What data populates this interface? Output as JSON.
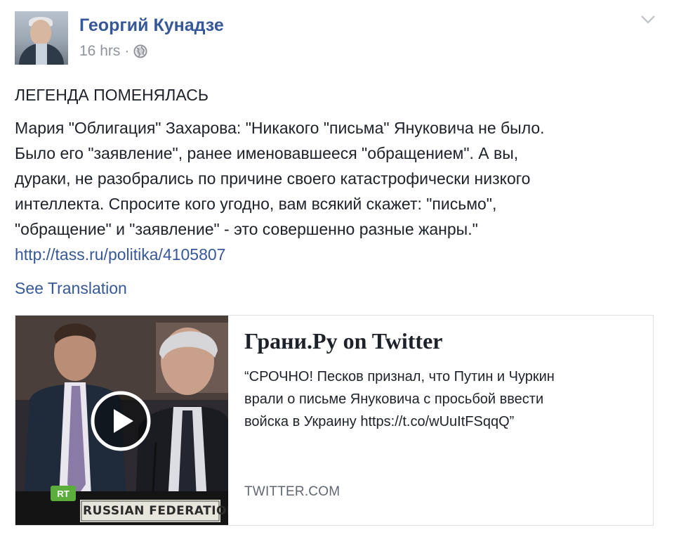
{
  "post": {
    "author_name": "Георгий Кунадзе",
    "timestamp": "16 hrs",
    "separator": "·",
    "privacy_icon": "globe-icon",
    "menu_icon": "chevron-down-icon",
    "headline": "ЛЕГЕНДА ПОМЕНЯЛАСЬ",
    "text_lines": [
      "Мария \"Облигация\" Захарова: \"Никакого \"письма\" Януковича не было.",
      "Было его \"заявление\", ранее именовавшееся \"обращением\". А вы,",
      "дураки, не разобрались по причине своего катастрофически низкого",
      "интеллекта. Спросите кого угодно, вам всякий скажет: \"письмо\",",
      "\"обращение\" и \"заявление\" - это совершенно разные жанры.\""
    ],
    "link": "http://tass.ru/politika/4105807",
    "see_translation": "See Translation"
  },
  "link_card": {
    "title": "Грани.Ру on Twitter",
    "description_lines": [
      "“СРОЧНО! Песков признал, что Путин и Чуркин",
      "врали о письме Януковича с просьбой ввести",
      "войска в Украину https://t.co/wUuItFSqqQ”"
    ],
    "domain": "TWITTER.COM",
    "thumbnail": {
      "play_icon": "play-icon",
      "channel_logo": "RT",
      "nameplate": "RUSSIAN FEDERATION"
    }
  },
  "colors": {
    "link_blue": "#365899",
    "text": "#1d2129",
    "meta_gray": "#90949c",
    "border": "#dddfe2"
  }
}
